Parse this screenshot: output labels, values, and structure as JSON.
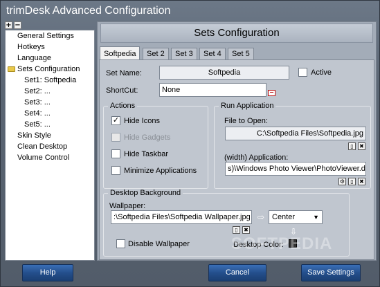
{
  "window": {
    "title": "trimDesk Advanced Configuration"
  },
  "tree_toolbar": {
    "expand": "+",
    "collapse": "−"
  },
  "tree": {
    "items": [
      "General Settings",
      "Hotkeys",
      "Language",
      "Sets Configuration",
      "Set1: Softpedia",
      "Set2: ...",
      "Set3: ...",
      "Set4: ...",
      "Set5: ...",
      "Skin Style",
      "Clean Desktop",
      "Volume Control"
    ]
  },
  "header": {
    "title": "Sets Configuration"
  },
  "tabs": [
    "Softpedia",
    "Set 2",
    "Set 3",
    "Set 4",
    "Set 5"
  ],
  "set": {
    "name_label": "Set Name:",
    "name_value": "Softpedia",
    "active_label": "Active",
    "active_checked": false,
    "shortcut_label": "ShortCut:",
    "shortcut_value": "None"
  },
  "actions": {
    "title": "Actions",
    "items": [
      {
        "label": "Hide Icons",
        "checked": true,
        "enabled": true
      },
      {
        "label": "Hide Gadgets",
        "checked": false,
        "enabled": false
      },
      {
        "label": "Hide Taskbar",
        "checked": false,
        "enabled": true
      },
      {
        "label": "Minimize Applications",
        "checked": false,
        "enabled": true
      }
    ]
  },
  "run": {
    "title": "Run Application",
    "file_label": "File to Open:",
    "file_value": "C:\\Softpedia Files\\Softpedia.jpg",
    "app_label": "(width) Application:",
    "app_value": "s)\\Windows Photo Viewer\\PhotoViewer.dll"
  },
  "background": {
    "title": "Desktop Background",
    "wallpaper_label": "Wallpaper:",
    "wallpaper_value": ":\\Softpedia Files\\Softpedia Wallpaper.jpg",
    "position_value": "Center",
    "disable_label": "Disable Wallpaper",
    "color_label": "Desktop Color:"
  },
  "watermark": "SOFTPEDIA",
  "buttons": {
    "help": "Help",
    "cancel": "Cancel",
    "save": "Save Settings"
  }
}
